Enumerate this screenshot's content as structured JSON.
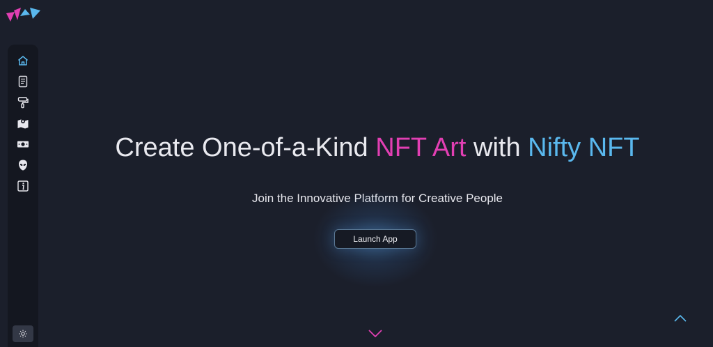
{
  "brand": {
    "logo_icon": "triangles-logo-icon",
    "colors": {
      "pink": "#e23fb3",
      "blue": "#5ab8ee",
      "background": "#1b1f2b",
      "sidebar": "#141720"
    }
  },
  "sidebar": {
    "items": [
      {
        "icon": "home-icon",
        "active": true
      },
      {
        "icon": "document-icon"
      },
      {
        "icon": "paint-roller-icon"
      },
      {
        "icon": "map-icon"
      },
      {
        "icon": "money-bill-icon"
      },
      {
        "icon": "alien-icon"
      },
      {
        "icon": "info-icon"
      }
    ],
    "theme_toggle_icon": "sun-icon"
  },
  "hero": {
    "title_part1": "Create One-of-a-Kind ",
    "title_highlight1": "NFT Art",
    "title_part2": " with ",
    "title_highlight2": "Nifty NFT",
    "subtitle": "Join the Innovative Platform for Creative People",
    "cta_label": "Launch App"
  },
  "scroll": {
    "down_icon": "chevron-down-icon",
    "up_icon": "chevron-up-icon"
  }
}
